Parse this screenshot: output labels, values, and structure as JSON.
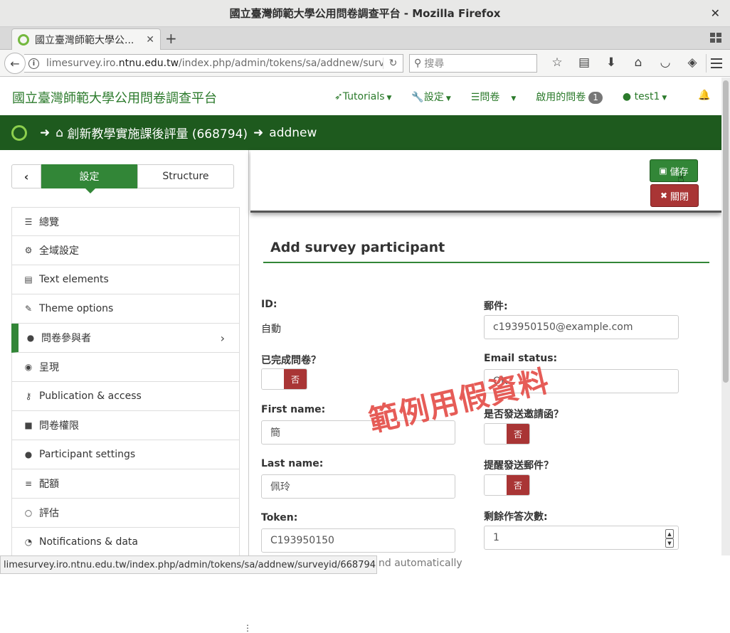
{
  "window": {
    "title": "國立臺灣師範大學公用問卷調查平台 - Mozilla Firefox",
    "close_glyph": "✕"
  },
  "tab": {
    "title": "國立臺灣師範大學公...",
    "close_glyph": "✕",
    "new_tab_glyph": "+"
  },
  "navbar": {
    "url_prefix": "limesurvey.iro.",
    "url_domain": "ntnu.edu.tw",
    "url_suffix": "/index.php/admin/tokens/sa/addnew/surve",
    "search_placeholder": "搜尋",
    "icons": [
      "star-icon",
      "reader-icon",
      "download-icon",
      "home-icon",
      "pocket-icon",
      "extension-icon"
    ]
  },
  "header": {
    "site_title": "國立臺灣師範大學公用問卷調查平台",
    "nav": {
      "tutorials": "Tutorials",
      "settings": "設定",
      "surveys": "問卷",
      "active_surveys": "啟用的問卷",
      "active_count": "1",
      "user": "test1"
    }
  },
  "breadcrumb": {
    "survey": "創新教學實施課後評量 (668794)",
    "page": "addnew"
  },
  "sidebar": {
    "tab_settings": "設定",
    "tab_structure": "Structure",
    "items": [
      {
        "label": "總覽",
        "icon": "list-icon",
        "glyph": "☰"
      },
      {
        "label": "全域設定",
        "icon": "gears-icon",
        "glyph": "⚙"
      },
      {
        "label": "Text elements",
        "icon": "file-text-icon",
        "glyph": "▤"
      },
      {
        "label": "Theme options",
        "icon": "paint-brush-icon",
        "glyph": "✎"
      },
      {
        "label": "問卷參與者",
        "icon": "user-icon",
        "glyph": "●"
      },
      {
        "label": "呈現",
        "icon": "eye-slash-icon",
        "glyph": "◉"
      },
      {
        "label": "Publication & access",
        "icon": "key-icon",
        "glyph": "⚷"
      },
      {
        "label": "問卷權限",
        "icon": "lock-icon",
        "glyph": "■"
      },
      {
        "label": "Participant settings",
        "icon": "users-icon",
        "glyph": "●"
      },
      {
        "label": "配額",
        "icon": "tasks-icon",
        "glyph": "≡"
      },
      {
        "label": "評估",
        "icon": "comment-icon",
        "glyph": "○"
      },
      {
        "label": "Notifications & data",
        "icon": "rss-icon",
        "glyph": "◔"
      }
    ]
  },
  "toolbar": {
    "save_label": "儲存",
    "close_label": "關閉"
  },
  "form": {
    "title": "Add survey participant",
    "id_label": "ID:",
    "id_value": "自動",
    "completed_label": "已完成問卷？",
    "completed_value": "否",
    "firstname_label": "First name:",
    "firstname_value": "簡",
    "lastname_label": "Last name:",
    "lastname_value": "佩玲",
    "token_label": "Token:",
    "token_value": "C193950150",
    "token_help": "nd automatically",
    "email_label": "郵件:",
    "email_value": "c193950150@example.com",
    "emailstatus_label": "Email status:",
    "emailstatus_value": "OK",
    "invite_label": "是否發送邀請函？",
    "invite_value": "否",
    "reminder_label": "提醒發送郵件？",
    "reminder_value": "否",
    "uses_label": "剩餘作答次數:",
    "uses_value": "1"
  },
  "watermark": "範例用假資料",
  "statusbar": "limesurvey.iro.ntnu.edu.tw/index.php/admin/tokens/sa/addnew/surveyid/668794#",
  "colors": {
    "brand_green": "#328637",
    "dark_green": "#1e5a1e",
    "danger_red": "#a93535",
    "watermark_red": "#e5544f"
  }
}
